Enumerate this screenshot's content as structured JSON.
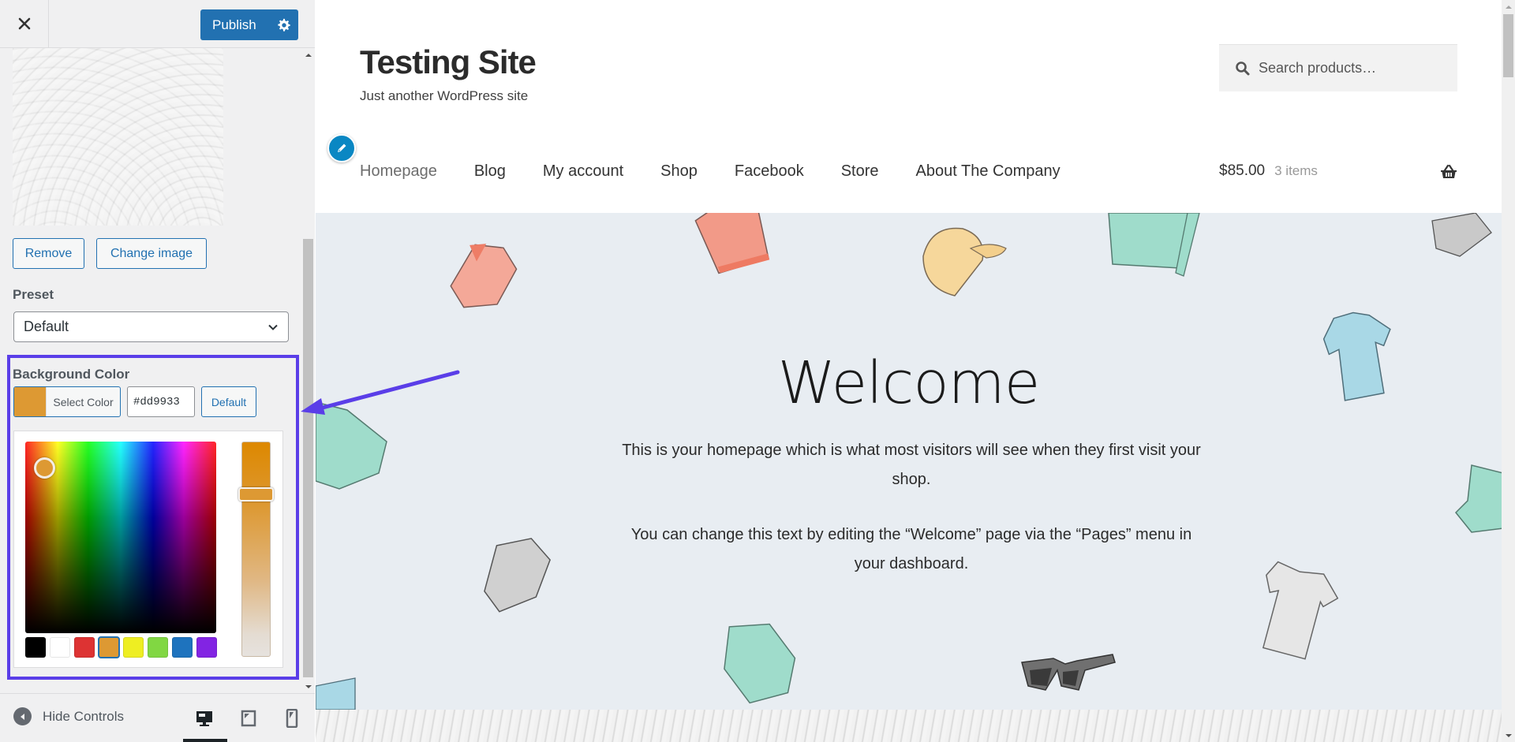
{
  "customizer": {
    "close_label": "Close",
    "publish_label": "Publish",
    "image_section": {
      "remove_label": "Remove",
      "change_label": "Change image"
    },
    "preset": {
      "label": "Preset",
      "selected": "Default"
    },
    "background_color": {
      "label": "Background Color",
      "select_color_label": "Select Color",
      "hex_value": "#dd9933",
      "default_label": "Default",
      "current_color": "#dd9933",
      "palette": [
        {
          "name": "black",
          "color": "#000000"
        },
        {
          "name": "white",
          "color": "#ffffff"
        },
        {
          "name": "red",
          "color": "#dd3333"
        },
        {
          "name": "orange",
          "color": "#dd9933",
          "selected": true
        },
        {
          "name": "yellow",
          "color": "#eeee22"
        },
        {
          "name": "green",
          "color": "#81d742"
        },
        {
          "name": "blue",
          "color": "#1e73be"
        },
        {
          "name": "purple",
          "color": "#8224e3"
        }
      ]
    },
    "footer": {
      "hide_controls_label": "Hide Controls",
      "devices": [
        "desktop",
        "tablet",
        "mobile"
      ],
      "active_device": "desktop"
    }
  },
  "site": {
    "title": "Testing Site",
    "tagline": "Just another WordPress site",
    "search_placeholder": "Search products…",
    "nav": [
      "Homepage",
      "Blog",
      "My account",
      "Shop",
      "Facebook",
      "Store",
      "About The Company"
    ],
    "current_nav": "Homepage",
    "cart": {
      "total": "$85.00",
      "count": "3 items"
    },
    "hero": {
      "title": "Welcome",
      "paragraph1": "This is your homepage which is what most visitors will see when they first visit your shop.",
      "paragraph2": "You can change this text by editing the “Welcome” page via the “Pages” menu in your dashboard."
    }
  },
  "colors": {
    "accent": "#2271b1",
    "highlight_box": "#5a3ee8",
    "hero_bg": "#e8edf2"
  }
}
